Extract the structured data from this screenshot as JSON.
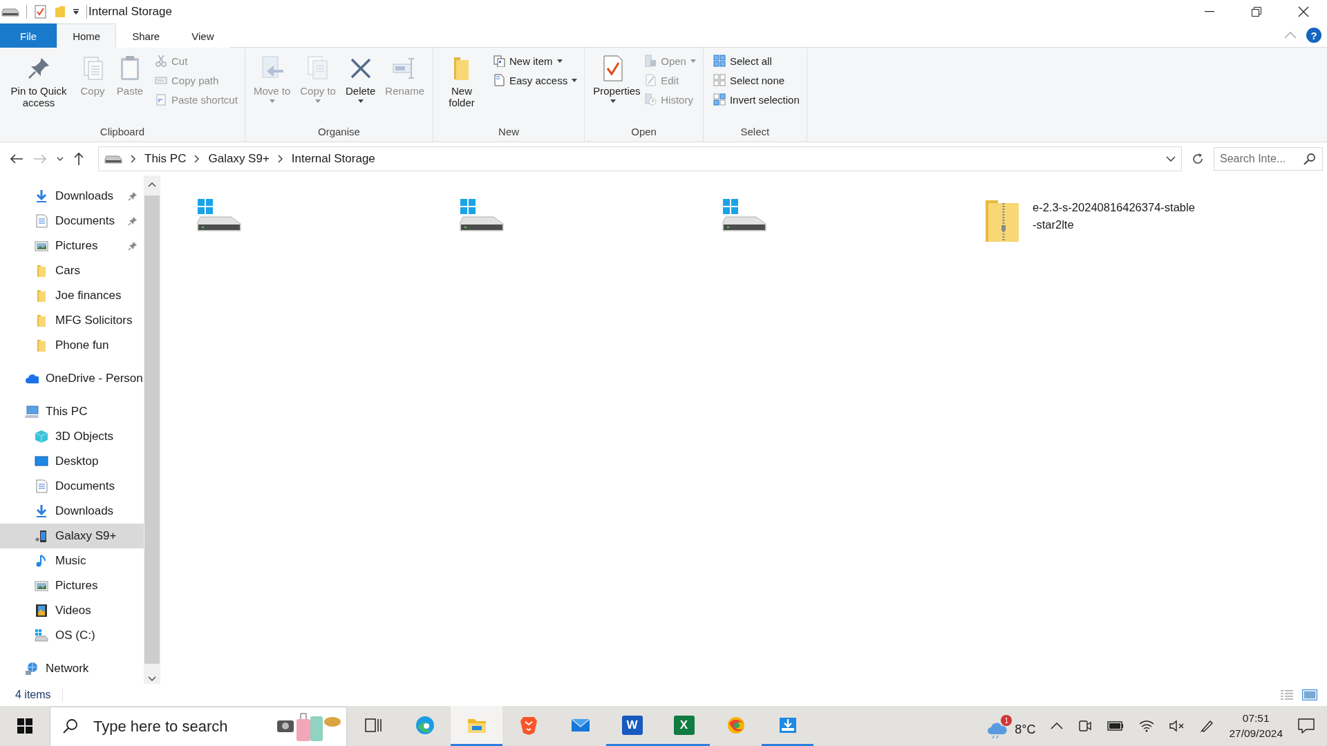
{
  "window": {
    "title": "Internal Storage"
  },
  "ribbon": {
    "tabs": [
      {
        "label": "File",
        "kind": "file",
        "selected": false
      },
      {
        "label": "Home",
        "kind": "tab",
        "selected": true
      },
      {
        "label": "Share",
        "kind": "tab",
        "selected": false
      },
      {
        "label": "View",
        "kind": "tab",
        "selected": false
      }
    ],
    "help": "?",
    "groups": [
      {
        "label": "Clipboard",
        "large_buttons": [
          {
            "label": "Pin to Quick access",
            "disabled": false,
            "dropdown": false
          },
          {
            "label": "Copy",
            "disabled": true,
            "dropdown": false
          },
          {
            "label": "Paste",
            "disabled": true,
            "dropdown": false
          }
        ],
        "small_buttons": [
          {
            "label": "Cut",
            "disabled": true,
            "dropdown": false
          },
          {
            "label": "Copy path",
            "disabled": true,
            "dropdown": false
          },
          {
            "label": "Paste shortcut",
            "disabled": true,
            "dropdown": false
          }
        ]
      },
      {
        "label": "Organise",
        "large_buttons": [
          {
            "label": "Move to",
            "disabled": true,
            "dropdown": true
          },
          {
            "label": "Copy to",
            "disabled": true,
            "dropdown": true
          },
          {
            "label": "Delete",
            "disabled": false,
            "dropdown": true
          },
          {
            "label": "Rename",
            "disabled": true,
            "dropdown": false
          }
        ]
      },
      {
        "label": "New",
        "large_buttons": [
          {
            "label": "New folder",
            "disabled": false,
            "dropdown": false
          }
        ],
        "small_buttons": [
          {
            "label": "New item",
            "disabled": false,
            "dropdown": true
          },
          {
            "label": "Easy access",
            "disabled": false,
            "dropdown": true
          }
        ]
      },
      {
        "label": "Open",
        "large_buttons": [
          {
            "label": "Properties",
            "disabled": false,
            "dropdown": true
          }
        ],
        "small_buttons": [
          {
            "label": "Open",
            "disabled": true,
            "dropdown": true
          },
          {
            "label": "Edit",
            "disabled": true,
            "dropdown": false
          },
          {
            "label": "History",
            "disabled": true,
            "dropdown": false
          }
        ]
      },
      {
        "label": "Select",
        "small_buttons": [
          {
            "label": "Select all",
            "disabled": false,
            "dropdown": false
          },
          {
            "label": "Select none",
            "disabled": false,
            "dropdown": false
          },
          {
            "label": "Invert selection",
            "disabled": false,
            "dropdown": false
          }
        ]
      }
    ]
  },
  "address": {
    "breadcrumbs": [
      "This PC",
      "Galaxy S9+",
      "Internal Storage"
    ],
    "search_placeholder": "Search Inte..."
  },
  "navigation": {
    "quick_access": [
      {
        "label": "Downloads",
        "kind": "downloads",
        "pinned": true,
        "selected": false
      },
      {
        "label": "Documents",
        "kind": "documents",
        "pinned": true,
        "selected": false
      },
      {
        "label": "Pictures",
        "kind": "pictures",
        "pinned": true,
        "selected": false
      },
      {
        "label": "Cars",
        "kind": "folder",
        "pinned": false,
        "selected": false
      },
      {
        "label": "Joe finances",
        "kind": "folder",
        "pinned": false,
        "selected": false
      },
      {
        "label": "MFG Solicitors",
        "kind": "folder",
        "pinned": false,
        "selected": false
      },
      {
        "label": "Phone fun",
        "kind": "folder",
        "pinned": false,
        "selected": false
      }
    ],
    "roots": [
      {
        "label": "OneDrive - Person",
        "kind": "cloud",
        "selected": false
      },
      {
        "label": "This PC",
        "kind": "pc",
        "selected": false,
        "children": [
          {
            "label": "3D Objects",
            "kind": "cube",
            "selected": false
          },
          {
            "label": "Desktop",
            "kind": "desktop",
            "selected": false
          },
          {
            "label": "Documents",
            "kind": "documents",
            "selected": false
          },
          {
            "label": "Downloads",
            "kind": "downloads",
            "selected": false
          },
          {
            "label": "Galaxy S9+",
            "kind": "phone",
            "selected": true
          },
          {
            "label": "Music",
            "kind": "music",
            "selected": false
          },
          {
            "label": "Pictures",
            "kind": "pictures",
            "selected": false
          },
          {
            "label": "Videos",
            "kind": "videos",
            "selected": false
          },
          {
            "label": "OS (C:)",
            "kind": "drive",
            "selected": false
          }
        ]
      },
      {
        "label": "Network",
        "kind": "network",
        "selected": false
      }
    ]
  },
  "content": {
    "items": [
      {
        "kind": "drive"
      },
      {
        "kind": "drive"
      },
      {
        "kind": "drive"
      },
      {
        "kind": "archive",
        "name": "e-2.3-s-20240816426374-stable-star2lte"
      }
    ]
  },
  "status_bar": {
    "item_count": "4 items"
  },
  "taskbar": {
    "search_placeholder": "Type here to search",
    "apps": [
      {
        "kind": "taskview",
        "running": false,
        "active": false
      },
      {
        "kind": "browser",
        "running": false,
        "active": false
      },
      {
        "kind": "files",
        "running": true,
        "active": true
      },
      {
        "kind": "lion",
        "running": false,
        "active": false
      },
      {
        "kind": "mail",
        "running": false,
        "active": false
      },
      {
        "kind": "writer",
        "glyph": "W",
        "running": true,
        "active": false
      },
      {
        "kind": "sheet",
        "glyph": "X",
        "running": true,
        "active": false
      },
      {
        "kind": "browser2",
        "running": false,
        "active": false
      },
      {
        "kind": "installer",
        "running": true,
        "active": false
      }
    ],
    "weather": {
      "badge": "1",
      "temperature": "8°C"
    },
    "clock": {
      "time": "07:51",
      "date": "27/09/2024"
    }
  }
}
